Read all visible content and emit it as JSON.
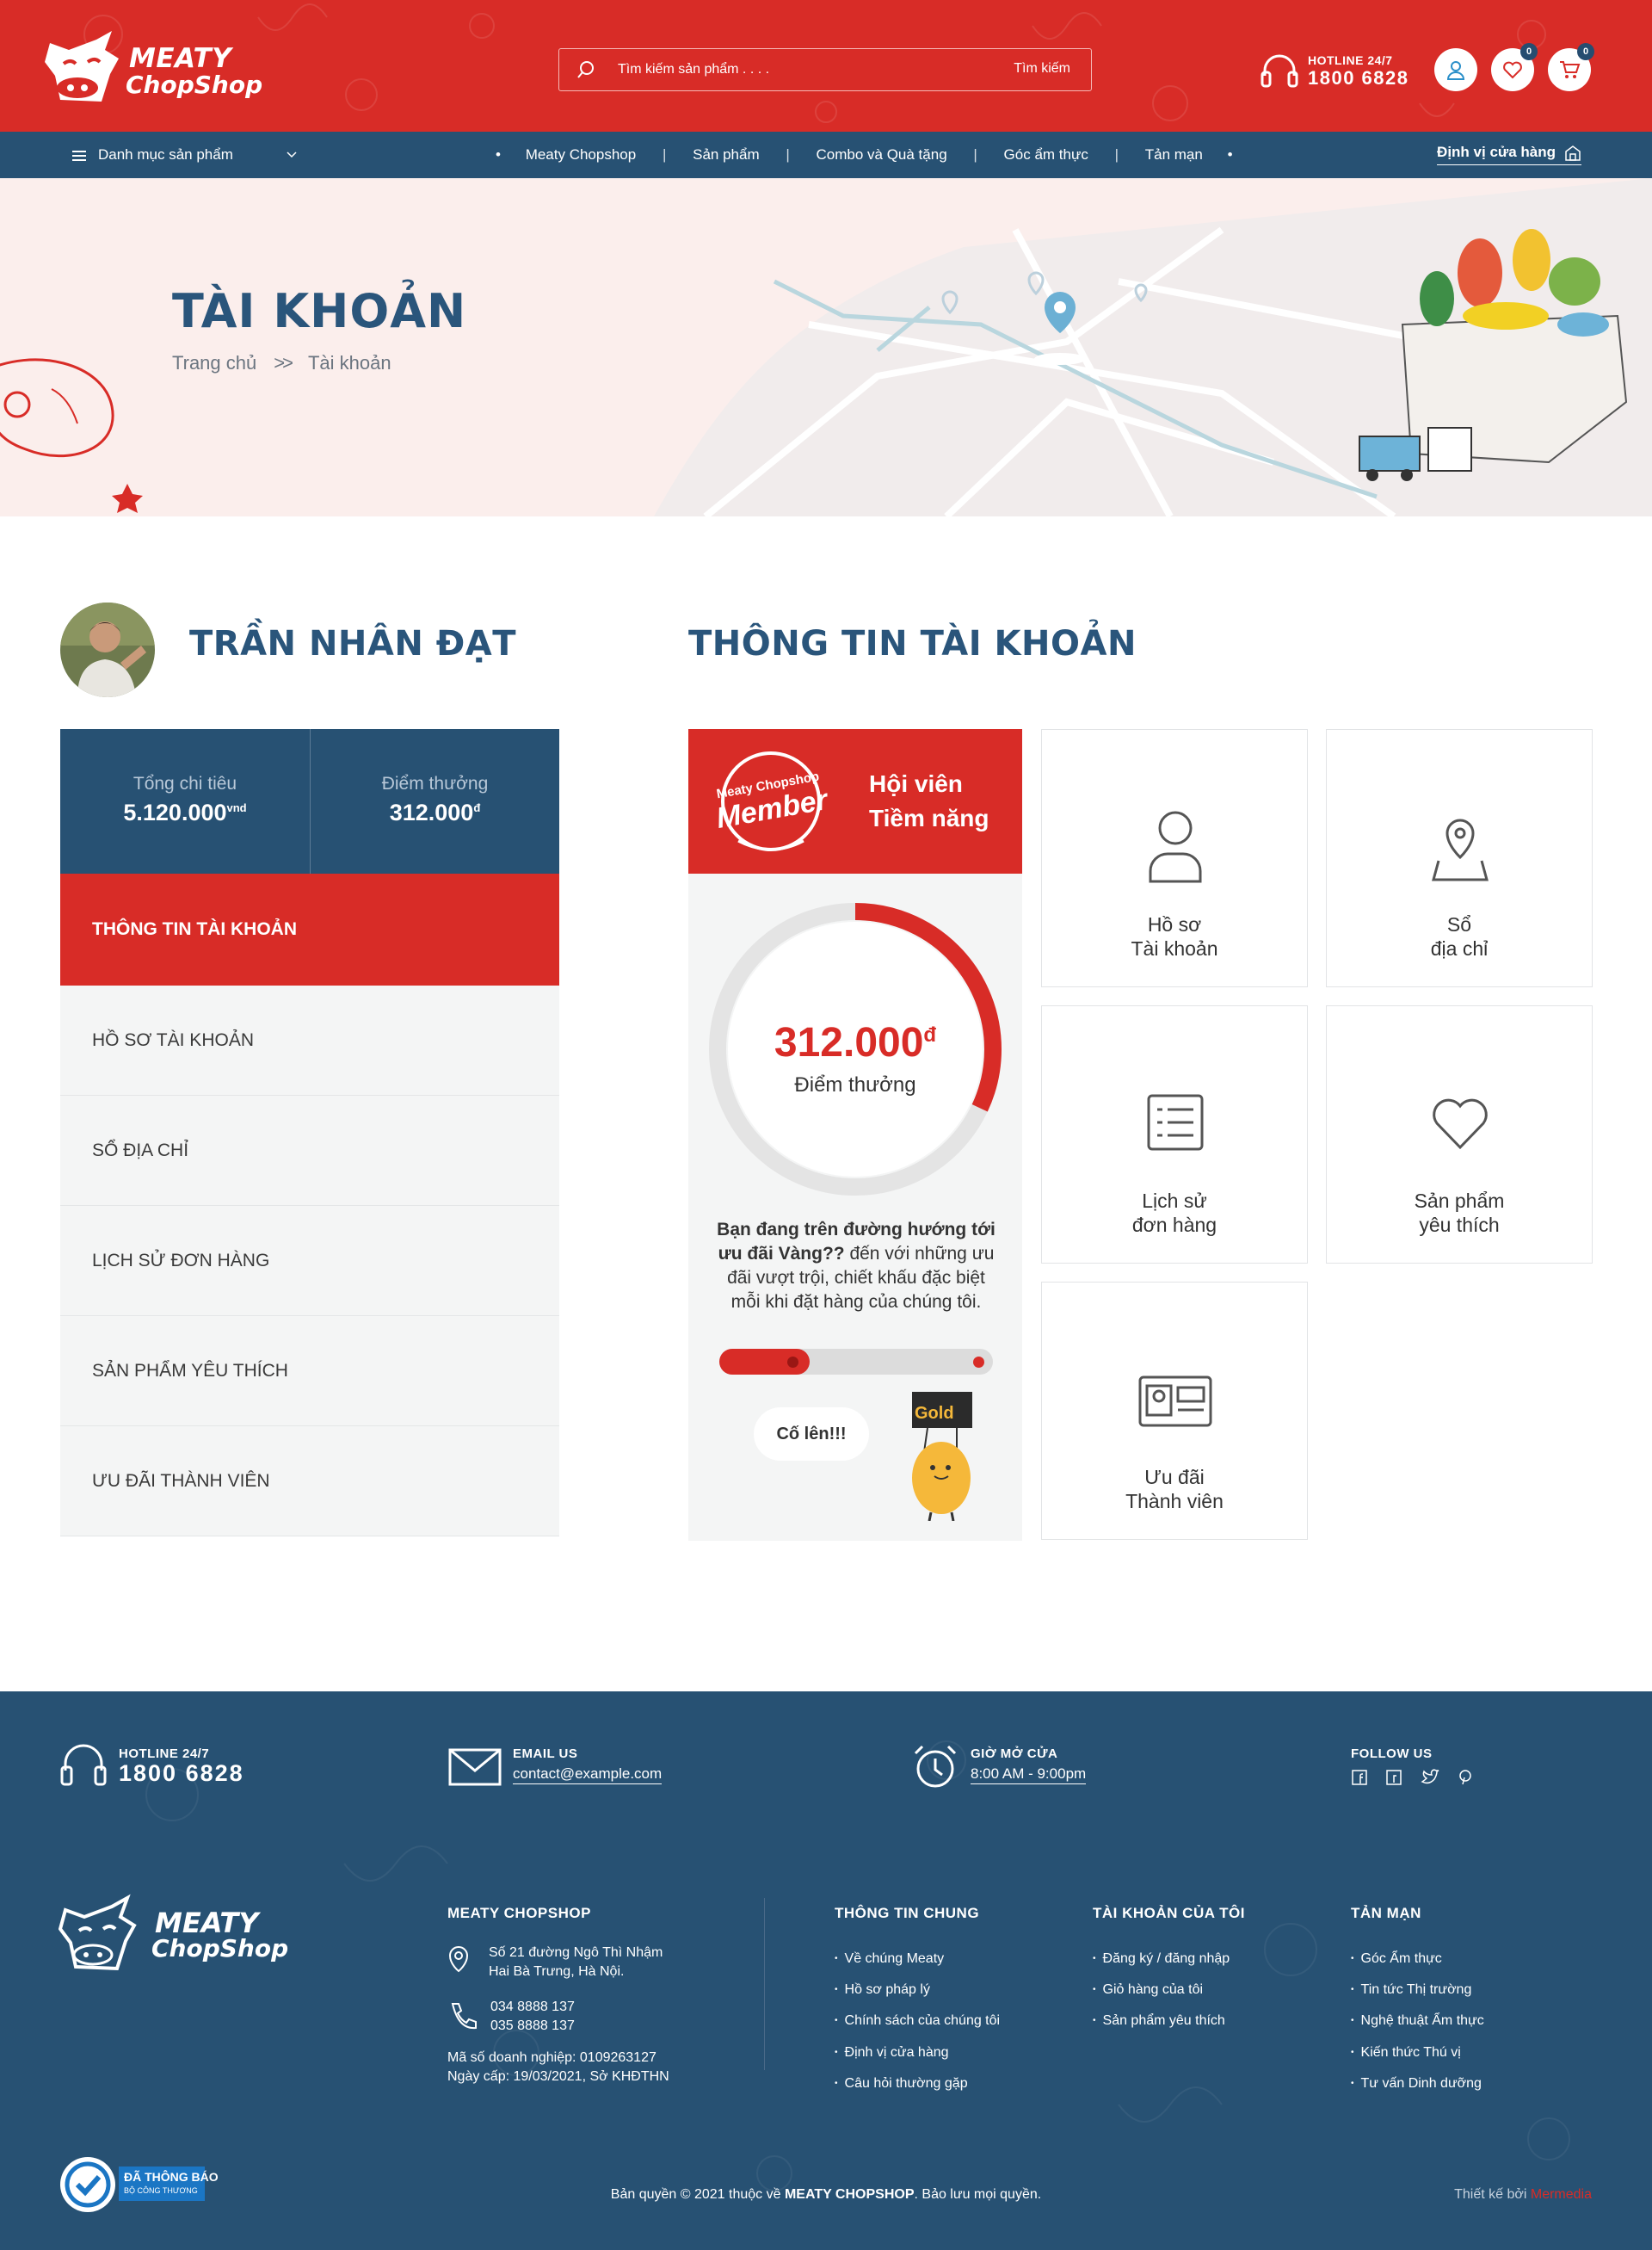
{
  "header": {
    "logo_line1": "MEATY",
    "logo_line2": "ChopShop",
    "search_placeholder": "Tìm kiếm sản phẩm . . . .",
    "search_button": "Tìm kiếm",
    "hotline_label": "HOTLINE 24/7",
    "hotline_number": "1800 6828",
    "wishlist_count": "0",
    "cart_count": "0"
  },
  "nav": {
    "categories_label": "Danh mục sản phẩm",
    "links": [
      "Meaty Chopshop",
      "Sản phẩm",
      "Combo và Quà tặng",
      "Góc ẩm thực",
      "Tản mạn"
    ],
    "store_locator": "Định vị cửa hàng"
  },
  "banner": {
    "title": "TÀI KHOẢN",
    "breadcrumb_home": "Trang chủ",
    "breadcrumb_sep": ">>",
    "breadcrumb_current": "Tài khoản"
  },
  "profile": {
    "name": "TRẦN NHÂN ĐẠT",
    "total_spend_label": "Tổng chi tiêu",
    "total_spend_value": "5.120.000",
    "total_spend_unit": "vnd",
    "points_label": "Điểm thưởng",
    "points_value": "312.000",
    "points_unit": "đ"
  },
  "menu": {
    "items": [
      "THÔNG TIN TÀI KHOẢN",
      "HỒ SƠ TÀI KHOẢN",
      "SỔ ĐỊA CHỈ",
      "LỊCH SỬ ĐƠN HÀNG",
      "SẢN PHẨM YÊU THÍCH",
      "ƯU ĐÃI THÀNH VIÊN"
    ]
  },
  "section_title": "THÔNG TIN TÀI KHOẢN",
  "member": {
    "badge_line1": "Meaty Chopshop",
    "badge_line2": "Member",
    "tier_line1": "Hội viên",
    "tier_line2": "Tiềm năng",
    "points_value": "312.000",
    "points_unit": "đ",
    "points_label": "Điểm thưởng",
    "message_bold": "Bạn đang trên đường hướng tới ưu đãi Vàng??",
    "message_rest": " đến với những ưu đãi vượt trội, chiết khấu đặc biệt mỗi khi đặt hàng của chúng tôi.",
    "progress_to_gold": 0.33,
    "ring_progress": 0.32,
    "cheer": "Cố lên!!!",
    "gold_sign": "Gold"
  },
  "tiles": [
    {
      "line1": "Hồ sơ",
      "line2": "Tài khoản"
    },
    {
      "line1": "Sổ",
      "line2": "địa chỉ"
    },
    {
      "line1": "Lịch sử",
      "line2": "đơn hàng"
    },
    {
      "line1": "Sản phẩm",
      "line2": "yêu thích"
    },
    {
      "line1": "Ưu đãi",
      "line2": "Thành viên"
    }
  ],
  "footer": {
    "hotline_label": "HOTLINE 24/7",
    "hotline_number": "1800 6828",
    "email_label": "EMAIL US",
    "email_value": "contact@example.com",
    "hours_label": "GIỜ MỞ CỬA",
    "hours_value": "8:00 AM  -  9:00pm",
    "follow_label": "FOLLOW US",
    "col1_title": "MEATY CHOPSHOP",
    "address_line1": "Số 21 đường Ngô Thì Nhậm",
    "address_line2": "Hai Bà Trưng, Hà Nội.",
    "phone1": "034 8888 137",
    "phone2": "035 8888 137",
    "reg_line1": "Mã số doanh nghiệp: 0109263127",
    "reg_line2": "Ngày cấp: 19/03/2021, Sở KHĐTHN",
    "col2_title": "THÔNG TIN CHUNG",
    "col2_items": [
      "Về chúng Meaty",
      "Hồ sơ pháp lý",
      "Chính sách của chúng tôi",
      "Định vị cửa hàng",
      "Câu hỏi thường gặp"
    ],
    "col3_title": "TÀI KHOẢN CỦA TÔI",
    "col3_items": [
      "Đăng ký / đăng nhập",
      "Giỏ hàng của tôi",
      "Sản phẩm yêu thích"
    ],
    "col4_title": "TẢN MẠN",
    "col4_items": [
      "Góc Ẩm thực",
      "Tin tức Thị trường",
      "Nghệ thuật Ẩm thực",
      "Kiến thức Thú vị",
      "Tư vấn Dinh dưỡng"
    ],
    "badge_line1": "ĐÃ THÔNG BÁO",
    "badge_line2": "BỘ CÔNG THƯƠNG",
    "copyright_pre": "Bản quyền © 2021 thuộc về ",
    "copyright_brand": "MEATY CHOPSHOP",
    "copyright_post": ". Bảo lưu mọi quyền.",
    "designer_pre": "Thiết kế bởi ",
    "designer_name": "Mermedia"
  },
  "colors": {
    "brand_red": "#d82c27",
    "brand_navy": "#275173",
    "title_blue": "#2a557b"
  }
}
